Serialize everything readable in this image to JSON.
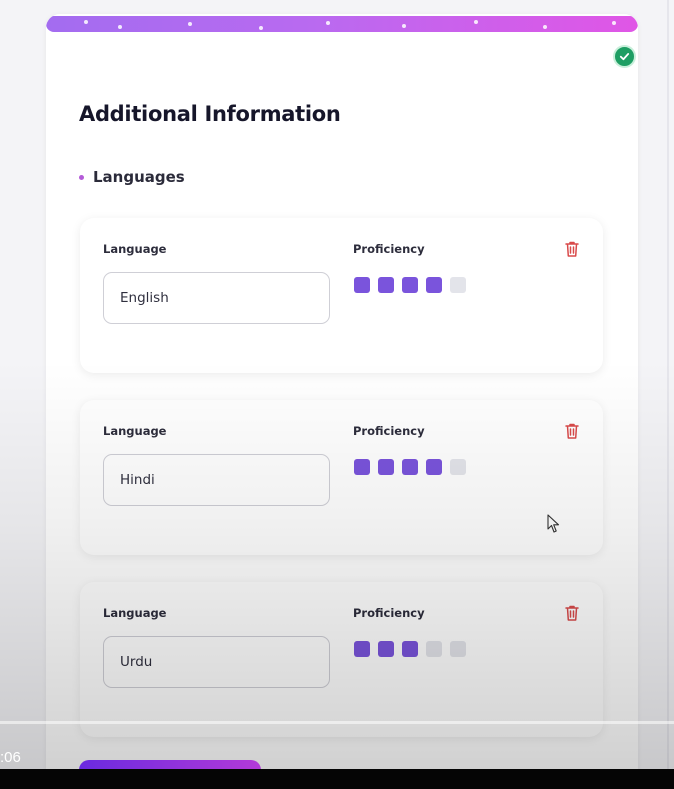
{
  "section": {
    "title": "Additional Information"
  },
  "languages": {
    "heading": "Languages",
    "field_label": "Language",
    "proficiency_label": "Proficiency",
    "max_level": 5,
    "items": [
      {
        "language": "English",
        "proficiency": 4
      },
      {
        "language": "Hindi",
        "proficiency": 4
      },
      {
        "language": "Urdu",
        "proficiency": 3
      }
    ]
  },
  "video": {
    "time": ":06"
  },
  "colors": {
    "accent": "#7a54dc",
    "accent_gradient_start": "#a36cf0",
    "accent_gradient_end": "#e056e6",
    "success": "#1e9e63",
    "danger": "#d94a4a"
  },
  "icons": {
    "completed": "check-icon",
    "delete": "trash-icon"
  }
}
